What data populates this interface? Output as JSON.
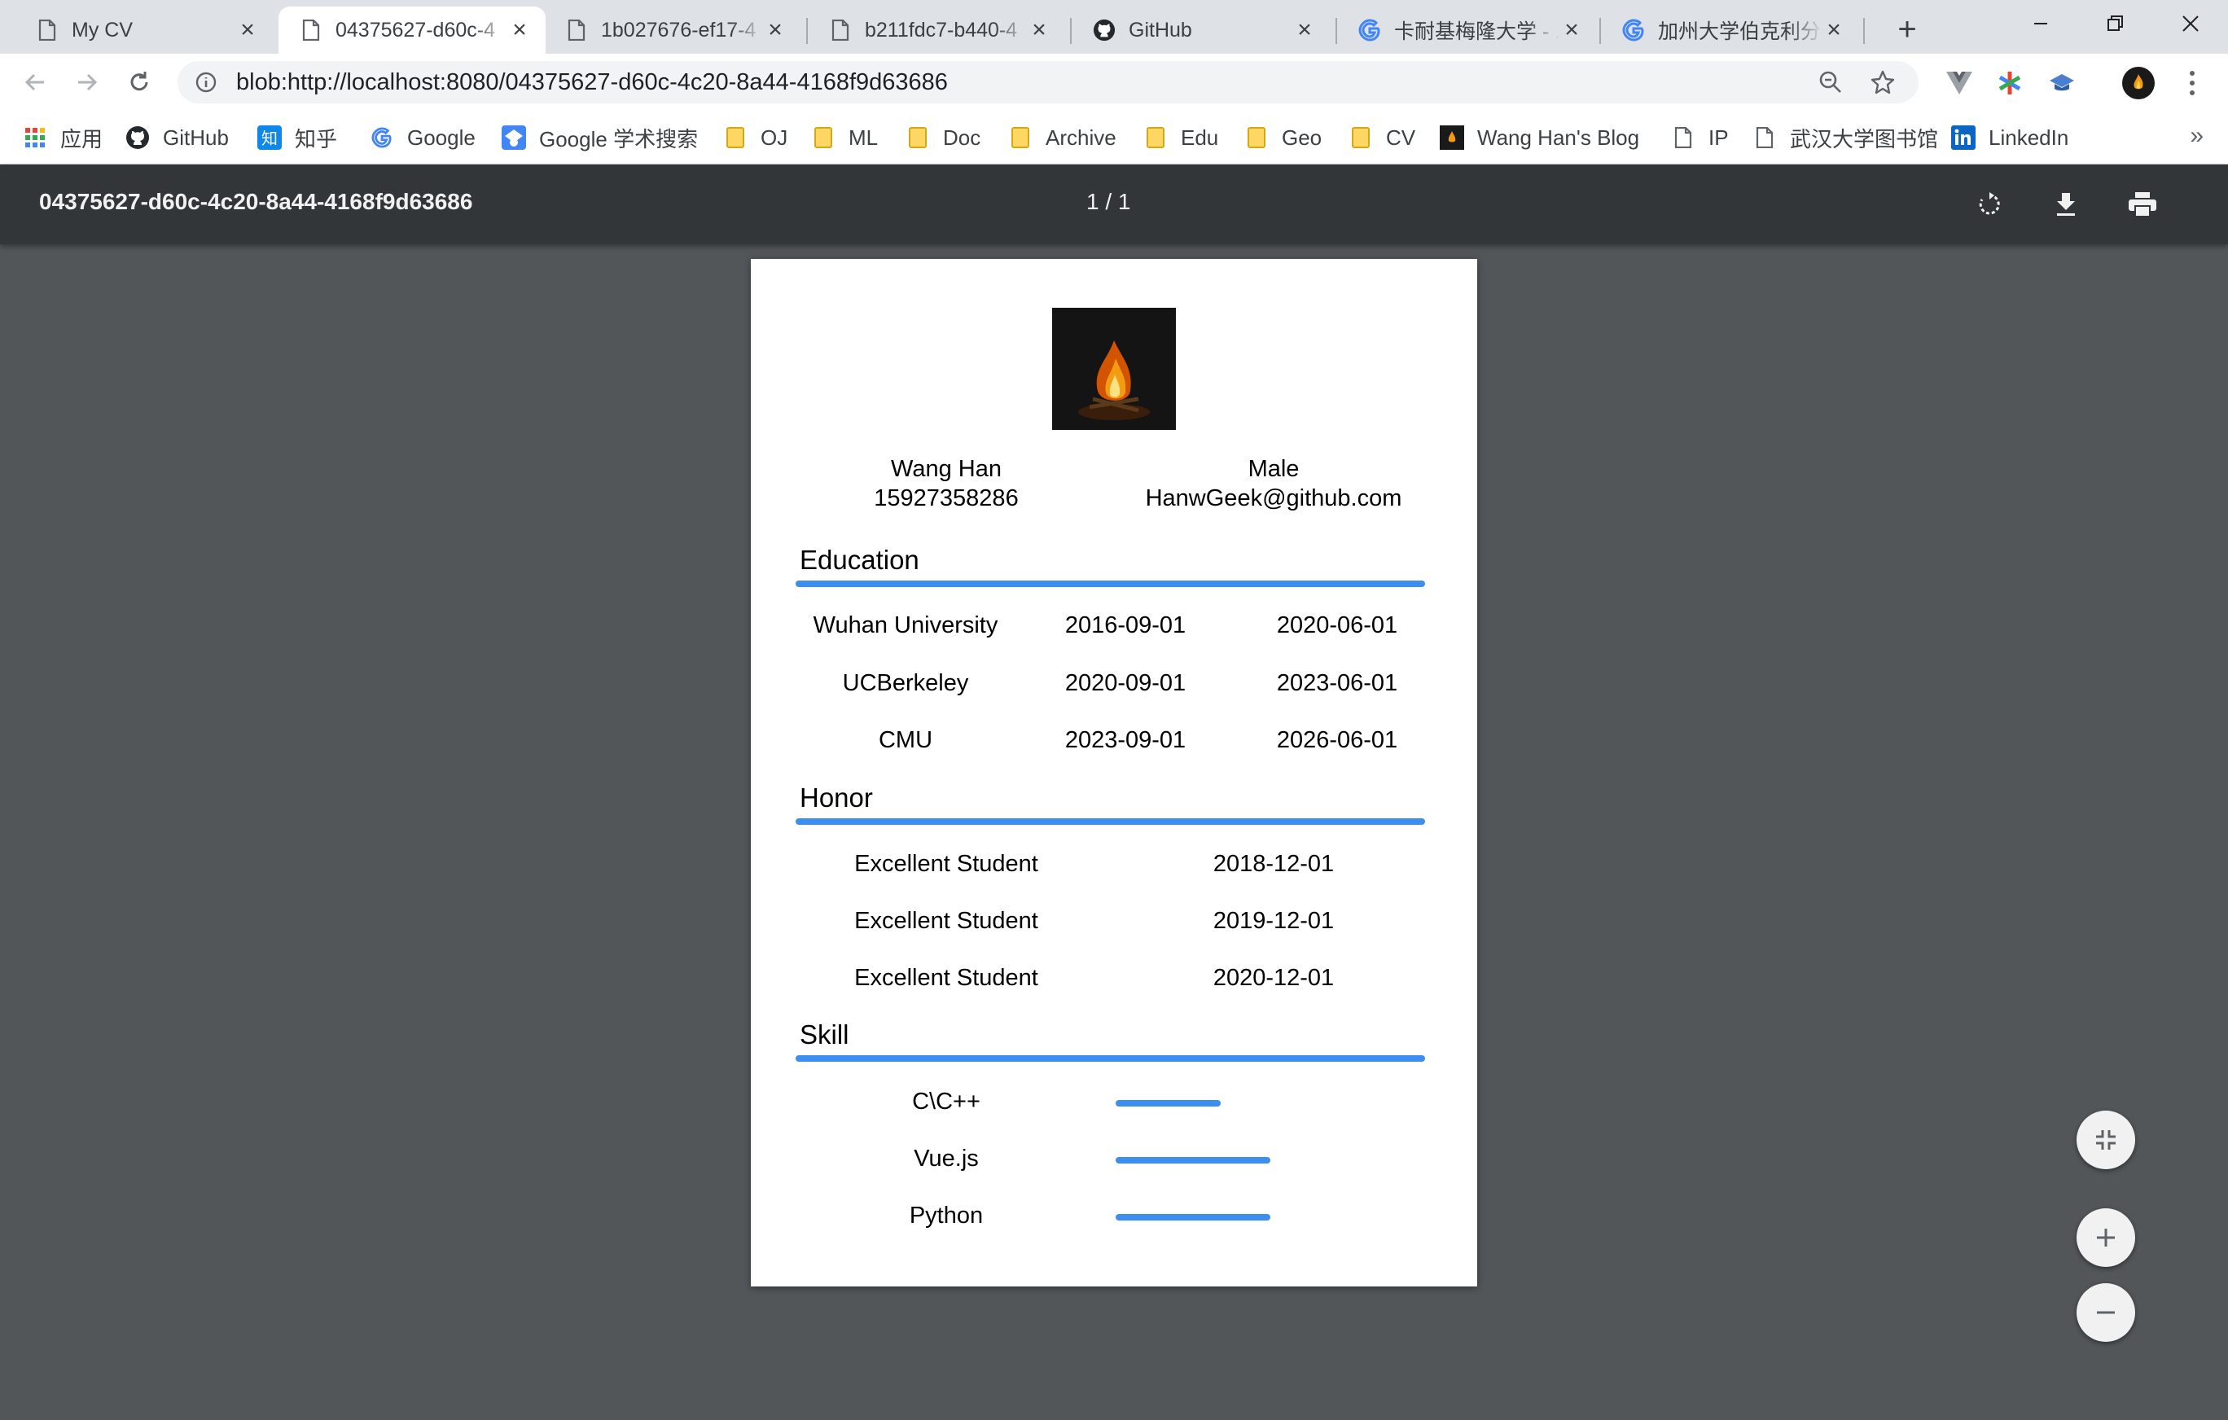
{
  "tabs": [
    {
      "title": "My CV"
    },
    {
      "title": "04375627-d60c-4"
    },
    {
      "title": "1b027676-ef17-4"
    },
    {
      "title": "b211fdc7-b440-4"
    },
    {
      "title": "GitHub"
    },
    {
      "title": "卡耐基梅隆大学 - ..."
    },
    {
      "title": "加州大学伯克利分校"
    }
  ],
  "address": {
    "url": "blob:http://localhost:8080/04375627-d60c-4c20-8a44-4168f9d63686"
  },
  "bookmarks": [
    {
      "label": "应用"
    },
    {
      "label": "GitHub"
    },
    {
      "label": "知乎"
    },
    {
      "label": "Google"
    },
    {
      "label": "Google 学术搜索"
    },
    {
      "label": "OJ"
    },
    {
      "label": "ML"
    },
    {
      "label": "Doc"
    },
    {
      "label": "Archive"
    },
    {
      "label": "Edu"
    },
    {
      "label": "Geo"
    },
    {
      "label": "CV"
    },
    {
      "label": "Wang Han's Blog"
    },
    {
      "label": "IP"
    },
    {
      "label": "武汉大学图书馆"
    },
    {
      "label": "LinkedIn"
    }
  ],
  "bookmarks_more": "»",
  "pdf": {
    "title": "04375627-d60c-4c20-8a44-4168f9d63686",
    "page_indicator": "1  /  1"
  },
  "cv": {
    "name": "Wang Han",
    "gender": "Male",
    "phone": "15927358286",
    "email": "HanwGeek@github.com",
    "sections": {
      "education": "Education",
      "honor": "Honor",
      "skill": "Skill"
    },
    "education": [
      {
        "school": "Wuhan University",
        "start": "2016-09-01",
        "end": "2020-06-01"
      },
      {
        "school": "UCBerkeley",
        "start": "2020-09-01",
        "end": "2023-06-01"
      },
      {
        "school": "CMU",
        "start": "2023-09-01",
        "end": "2026-06-01"
      }
    ],
    "honors": [
      {
        "title": "Excellent Student",
        "date": "2018-12-01"
      },
      {
        "title": "Excellent Student",
        "date": "2019-12-01"
      },
      {
        "title": "Excellent Student",
        "date": "2020-12-01"
      }
    ],
    "skills": [
      {
        "name": "C\\C++",
        "level": 0.68
      },
      {
        "name": "Vue.js",
        "level": 1.0
      },
      {
        "name": "Python",
        "level": 1.0
      }
    ]
  },
  "colors": {
    "accent": "#3c8ff0",
    "viewer_bg": "#525659",
    "toolbar": "#323639"
  }
}
